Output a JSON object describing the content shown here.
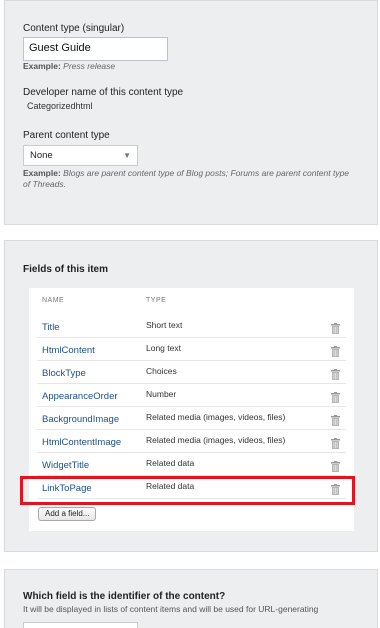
{
  "content_type": {
    "label": "Content type (singular)",
    "value": "Guest Guide",
    "example_prefix": "Example:",
    "example_text": "Press release"
  },
  "developer_name": {
    "label": "Developer name of this content type",
    "value": "Categorizedhtml"
  },
  "parent_type": {
    "label": "Parent content type",
    "selected": "None",
    "example_prefix": "Example:",
    "example_text": "Blogs are parent content type of Blog posts; Forums are parent content type of Threads."
  },
  "fields": {
    "title": "Fields of this item",
    "col_name": "NAME",
    "col_type": "TYPE",
    "rows": [
      {
        "name": "Title",
        "type": "Short text"
      },
      {
        "name": "HtmlContent",
        "type": "Long text"
      },
      {
        "name": "BlockType",
        "type": "Choices"
      },
      {
        "name": "AppearanceOrder",
        "type": "Number"
      },
      {
        "name": "BackgroundImage",
        "type": "Related media (images, videos, files)"
      },
      {
        "name": "HtmlContentImage",
        "type": "Related media (images, videos, files)"
      },
      {
        "name": "WidgetTitle",
        "type": "Related data"
      },
      {
        "name": "LinkToPage",
        "type": "Related data"
      }
    ],
    "add_label": "Add a field...",
    "highlight_color": "#e3141e"
  },
  "identifier": {
    "title": "Which field is the identifier of the content?",
    "help": "It will be displayed in lists of content items and will be used for URL-generating"
  }
}
